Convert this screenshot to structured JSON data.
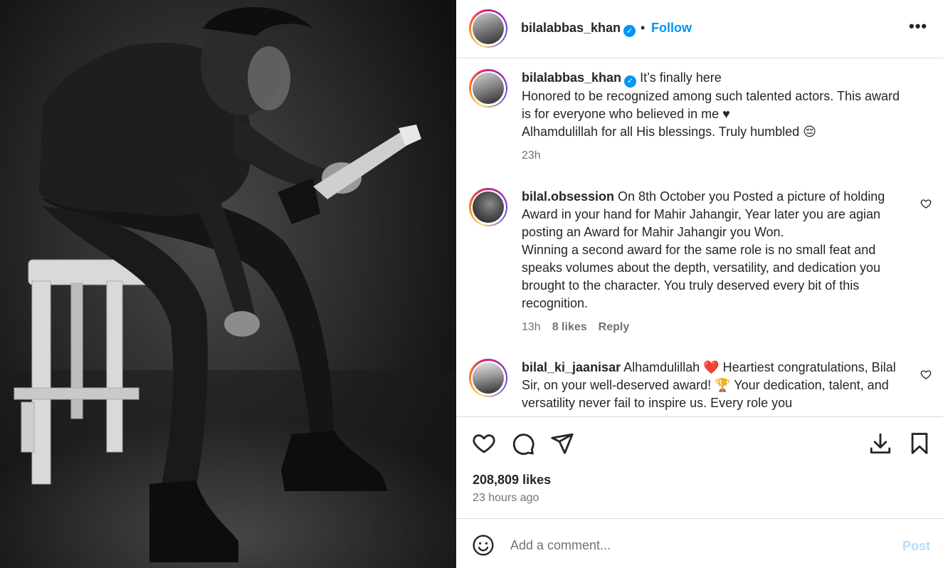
{
  "post_image": {
    "description_icon": "man-holding-award-photo"
  },
  "header": {
    "username": "bilalabbas_khan",
    "separator": "•",
    "follow_label": "Follow",
    "more_label": "•••"
  },
  "caption": {
    "username": "bilalabbas_khan",
    "line1": " It’s finally here",
    "line2": "Honored to be recognized among such talented actors. This award is for everyone who believed in me ♥",
    "line3": "Alhamdulillah for all His blessings. Truly humbled 😔",
    "time": "23h"
  },
  "comments": [
    {
      "username": "bilal.obsession",
      "text": " On 8th October you Posted a picture of holding Award in your hand for Mahir Jahangir, Year later you are agian posting an Award for Mahir Jahangir you Won.",
      "text2": "Winning a second award for the same role is no small feat and speaks volumes about the depth, versatility, and dedication you brought to the character. You truly deserved every bit of this recognition.",
      "time": "13h",
      "likes": "8 likes",
      "reply": "Reply"
    },
    {
      "username": "bilal_ki_jaanisar",
      "text": " Alhamdulillah ❤️ Heartiest congratulations, Bilal Sir, on your well-deserved award! 🏆 Your dedication, talent, and versatility never fail to inspire us. Every role you"
    }
  ],
  "stats": {
    "likes": "208,809 likes",
    "time": "23 hours ago"
  },
  "composer": {
    "placeholder": "Add a comment...",
    "post_label": "Post"
  },
  "colors": {
    "accent": "#0095f6",
    "text": "#262626",
    "muted": "#737373",
    "border": "#dbdbdb",
    "post_disabled": "#b2dffc"
  }
}
